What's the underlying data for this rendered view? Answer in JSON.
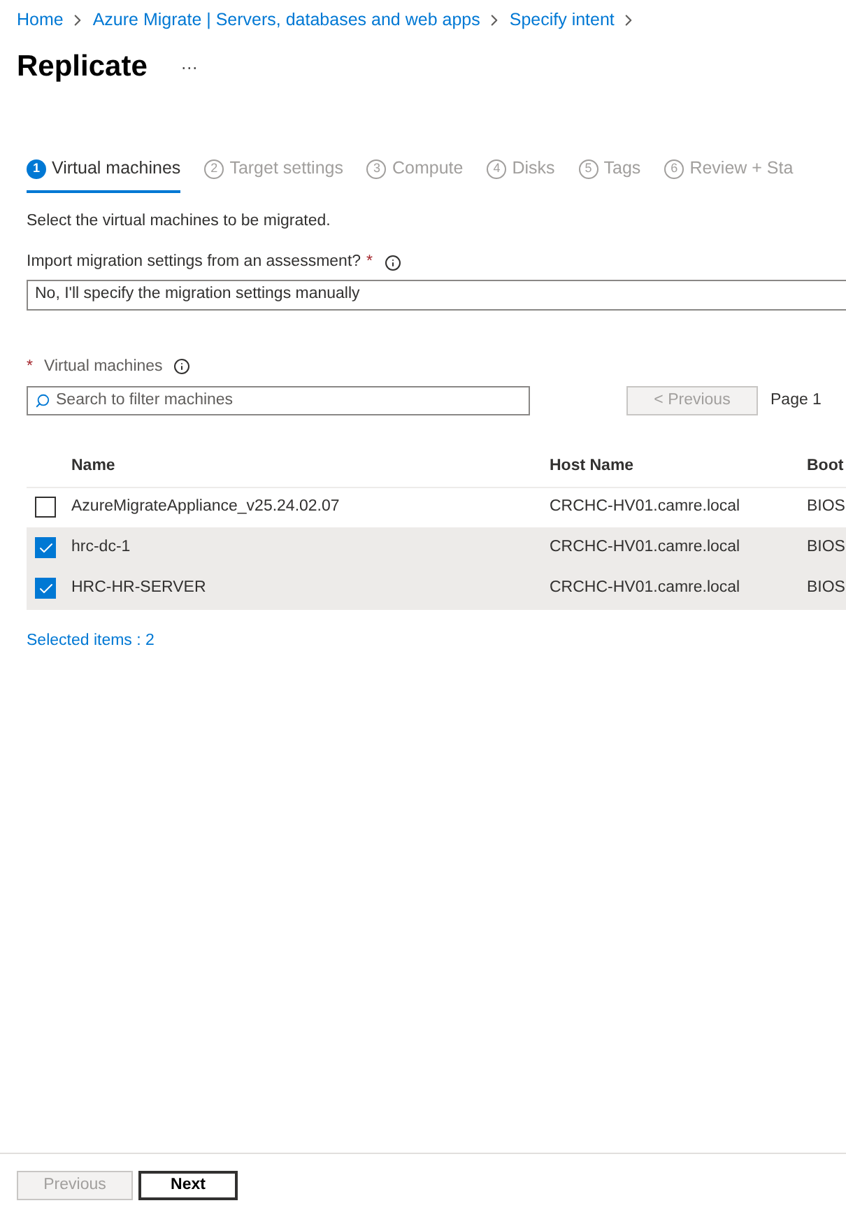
{
  "breadcrumb": [
    "Home",
    "Azure Migrate | Servers, databases and web apps",
    "Specify intent"
  ],
  "title": "Replicate",
  "more": "···",
  "tabs": [
    {
      "number": "1",
      "label": "Virtual machines",
      "selected": true
    },
    {
      "number": "2",
      "label": "Target settings",
      "selected": false
    },
    {
      "number": "3",
      "label": "Compute",
      "selected": false
    },
    {
      "number": "4",
      "label": "Disks",
      "selected": false
    },
    {
      "number": "5",
      "label": "Tags",
      "selected": false
    },
    {
      "number": "6",
      "label": "Review + Sta",
      "selected": false
    }
  ],
  "intro": "Select the virtual machines to be migrated.",
  "import_field": {
    "label": "Import migration settings from an assessment?",
    "required_mark": "*",
    "value": "No, I'll specify the migration settings manually"
  },
  "vm_field": {
    "required_mark": "*",
    "label": "Virtual machines"
  },
  "search": {
    "placeholder": "Search to filter machines"
  },
  "pager": {
    "previous": "< Previous",
    "previous_disabled": true,
    "page": "Page 1"
  },
  "table": {
    "columns": [
      "Name",
      "Host Name",
      "Boot"
    ],
    "rows": [
      {
        "selected": false,
        "cells": [
          "AzureMigrateAppliance_v25.24.02.07",
          "CRCHC-HV01.camre.local",
          "BIOS"
        ]
      },
      {
        "selected": true,
        "cells": [
          "hrc-dc-1",
          "CRCHC-HV01.camre.local",
          "BIOS"
        ]
      },
      {
        "selected": true,
        "cells": [
          "HRC-HR-SERVER",
          "CRCHC-HV01.camre.local",
          "BIOS"
        ]
      }
    ]
  },
  "selected_count": "Selected items : 2",
  "footer": {
    "previous": "Previous",
    "previous_disabled": true,
    "next": "Next"
  }
}
